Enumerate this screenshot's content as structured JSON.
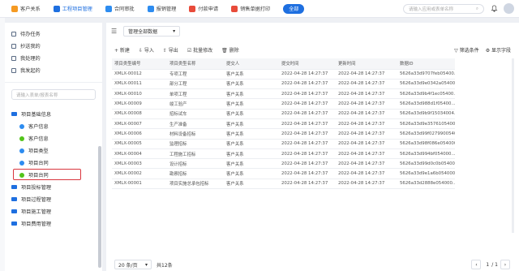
{
  "topbar": {
    "tabs": [
      {
        "label": "客户关系",
        "color": "#f59a23"
      },
      {
        "label": "工程项目管理",
        "color": "#1e6fe0"
      },
      {
        "label": "合同审批",
        "color": "#2d8cf0"
      },
      {
        "label": "报销管理",
        "color": "#2d8cf0"
      },
      {
        "label": "付款申请",
        "color": "#e84b3a"
      },
      {
        "label": "销售单据打印",
        "color": "#e84b3a"
      }
    ],
    "all_label": "全部",
    "search_placeholder": "请输入应用或表单名称"
  },
  "sidebar": {
    "tasks": [
      {
        "label": "待办任务"
      },
      {
        "label": "抄送我的"
      },
      {
        "label": "我处理的"
      },
      {
        "label": "我发起的"
      }
    ],
    "search_placeholder": "请输入表单/报表名称",
    "tree": {
      "group1": "项目基础信息",
      "children": [
        {
          "label": "客户信息",
          "color": "#2d8cf0"
        },
        {
          "label": "客户信息",
          "color": "#52c41a"
        },
        {
          "label": "项目类型",
          "color": "#2d8cf0"
        },
        {
          "label": "项目台同",
          "color": "#2d8cf0"
        },
        {
          "label": "项目台同",
          "color": "#52c41a"
        }
      ],
      "groups": [
        "项目投标管理",
        "项目过程管理",
        "项目施工管理",
        "项目费用管理"
      ]
    }
  },
  "main": {
    "view_select": "管理全部数据",
    "toolbar": {
      "new": "+ 新建",
      "import": "⇩ 导入",
      "export": "⇧ 导出",
      "batch_edit": "☑ 批量修改",
      "delete": "🗑 删除",
      "filter": "▽ 筛选条件",
      "fields": "⚙ 显示字段"
    },
    "columns": [
      "项目类型编号",
      "项目类型名称",
      "提交人",
      "提交时间",
      "更新时间",
      "数据ID"
    ],
    "rows": [
      [
        "XMLX-00012",
        "专项工程",
        "客户关系",
        "2022-04-28 14:27:37",
        "2022-04-28 14:27:37",
        "5626a33d9707feb05400..."
      ],
      [
        "XMLX-00011",
        "部分工程",
        "客户关系",
        "2022-04-28 14:27:37",
        "2022-04-28 14:27:37",
        "5626a33d9e0342a05400..."
      ],
      [
        "XMLX-00010",
        "单项工程",
        "客户关系",
        "2022-04-28 14:27:37",
        "2022-04-28 14:27:37",
        "5626a33d9b4f1ec05400..."
      ],
      [
        "XMLX-00009",
        "竣工验产",
        "客户关系",
        "2022-04-28 14:27:37",
        "2022-04-28 14:27:37",
        "5626a33d988d1f05400..."
      ],
      [
        "XMLX-00008",
        "招标试车",
        "客户关系",
        "2022-04-28 14:27:37",
        "2022-04-28 14:27:37",
        "5626a33d9b9f15034004..."
      ],
      [
        "XMLX-00007",
        "生产准备",
        "客户关系",
        "2022-04-28 14:27:37",
        "2022-04-28 14:27:37",
        "5626a33d9e35761054000..."
      ],
      [
        "XMLX-00006",
        "材料设备招标",
        "客户关系",
        "2022-04-28 14:27:37",
        "2022-04-28 14:27:37",
        "5626a33d99f027990054000..."
      ],
      [
        "XMLX-00005",
        "监理招标",
        "客户关系",
        "2022-04-28 14:27:37",
        "2022-04-28 14:27:37",
        "5626a33d98f086e054000..."
      ],
      [
        "XMLX-00004",
        "工程施工招标",
        "客户关系",
        "2022-04-28 14:27:37",
        "2022-04-28 14:27:37",
        "5626a33d994bf054000..."
      ],
      [
        "XMLX-00003",
        "设计招标",
        "客户关系",
        "2022-04-28 14:27:37",
        "2022-04-28 14:27:37",
        "5626a33d99d0c0b054000..."
      ],
      [
        "XMLX-00002",
        "勘察招标",
        "客户关系",
        "2022-04-28 14:27:37",
        "2022-04-28 14:27:37",
        "5626a33d9e1a6b054000..."
      ],
      [
        "XMLX-00001",
        "项目实施总承包招标",
        "客户关系",
        "2022-04-28 14:27:37",
        "2022-04-28 14:27:37",
        "5626a33d2888e054000..."
      ]
    ],
    "footer": {
      "page_size": "20 条/页",
      "total": "共12条",
      "page_current": "1",
      "page_sep": "/ 1"
    }
  }
}
